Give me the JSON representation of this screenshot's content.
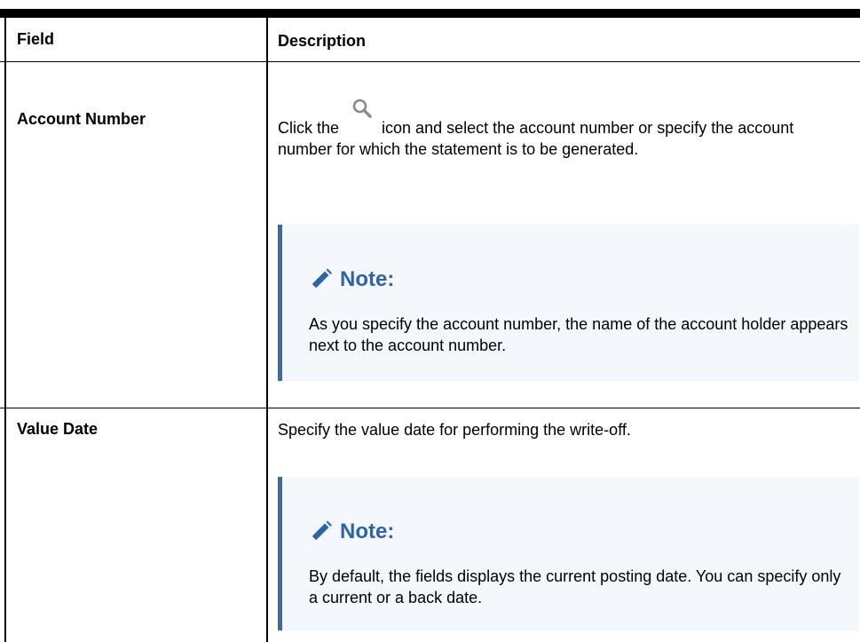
{
  "table": {
    "header": {
      "field": "Field",
      "description": "Description"
    },
    "rows": [
      {
        "field": "Account Number",
        "desc_before_icon": "Click the",
        "desc_after_icon": "icon and select the account number or specify the account number for which the statement is to be generated.",
        "icon": "search-icon",
        "note": {
          "title": "Note:",
          "text": "As you specify the account number, the name of the account holder appears next to the account number."
        }
      },
      {
        "field": "Value Date",
        "description": "Specify the value date for performing the write-off.",
        "note": {
          "title": "Note:",
          "text": "By default, the fields displays the current posting date. You can specify only a current or a back date."
        }
      }
    ]
  },
  "colors": {
    "note_accent": "#3b6aa6",
    "note_title": "#2e63a6",
    "note_bg": "#f4f8fd"
  }
}
